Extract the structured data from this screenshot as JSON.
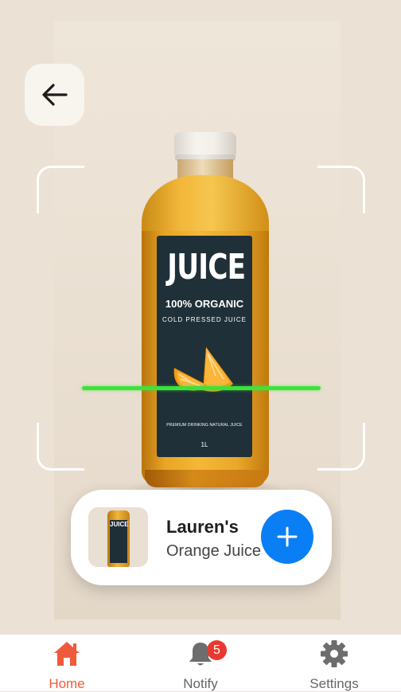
{
  "scanner": {
    "back_label": "Back"
  },
  "bottle_label": {
    "title": "JUICE",
    "organic": "100% ORGANIC",
    "cold_pressed": "COLD PRESSED JUICE",
    "premium": "PREMIUM DRINKING NATURAL JUICE",
    "size": "1L"
  },
  "product": {
    "brand": "Lauren's",
    "name": "Orange Juice",
    "thumb_title": "JUICE"
  },
  "nav": {
    "items": [
      {
        "label": "Home",
        "icon": "home-icon",
        "active": true
      },
      {
        "label": "Notify",
        "icon": "bell-icon",
        "badge": "5"
      },
      {
        "label": "Settings",
        "icon": "gear-icon"
      }
    ]
  },
  "colors": {
    "accent": "#0a7ff5",
    "active_nav": "#f05a3c",
    "scan_line": "#3de23a",
    "badge": "#e8392f"
  }
}
